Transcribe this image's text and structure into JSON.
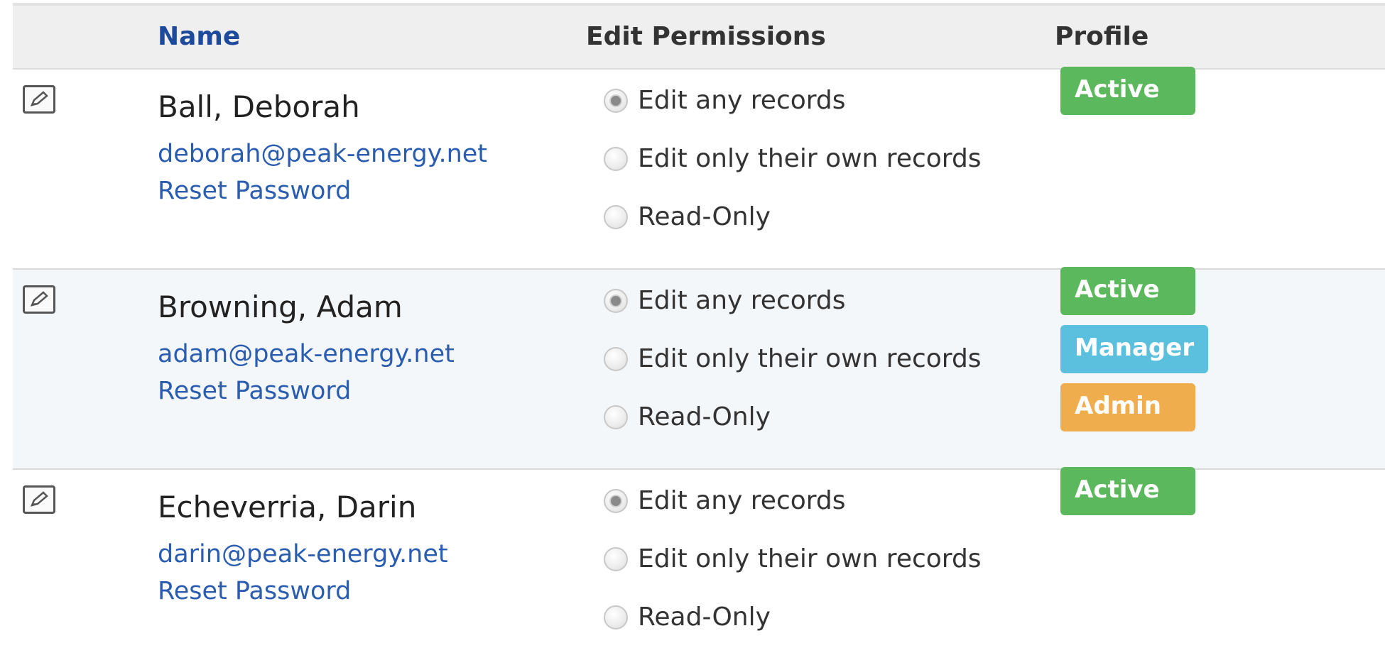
{
  "headers": {
    "name": "Name",
    "edit_permissions": "Edit Permissions",
    "profile": "Profile"
  },
  "permission_options": [
    "Edit any records",
    "Edit only their own records",
    "Read-Only"
  ],
  "users": [
    {
      "name": "Ball, Deborah",
      "email": "deborah@peak-energy.net",
      "reset_label": "Reset Password",
      "selected_permission": "Edit any records",
      "badges": [
        "Active"
      ]
    },
    {
      "name": "Browning, Adam",
      "email": "adam@peak-energy.net",
      "reset_label": "Reset Password",
      "selected_permission": "Edit any records",
      "badges": [
        "Active",
        "Manager",
        "Admin"
      ]
    },
    {
      "name": "Echeverria, Darin",
      "email": "darin@peak-energy.net",
      "reset_label": "Reset Password",
      "selected_permission": "Edit any records",
      "badges": [
        "Active"
      ]
    }
  ],
  "badge_colors": {
    "Active": "#5cb85c",
    "Manager": "#5bc0de",
    "Admin": "#f0ad4e"
  },
  "link_color": "#2a5db0",
  "icons": {
    "edit": "edit-pencil-icon"
  }
}
